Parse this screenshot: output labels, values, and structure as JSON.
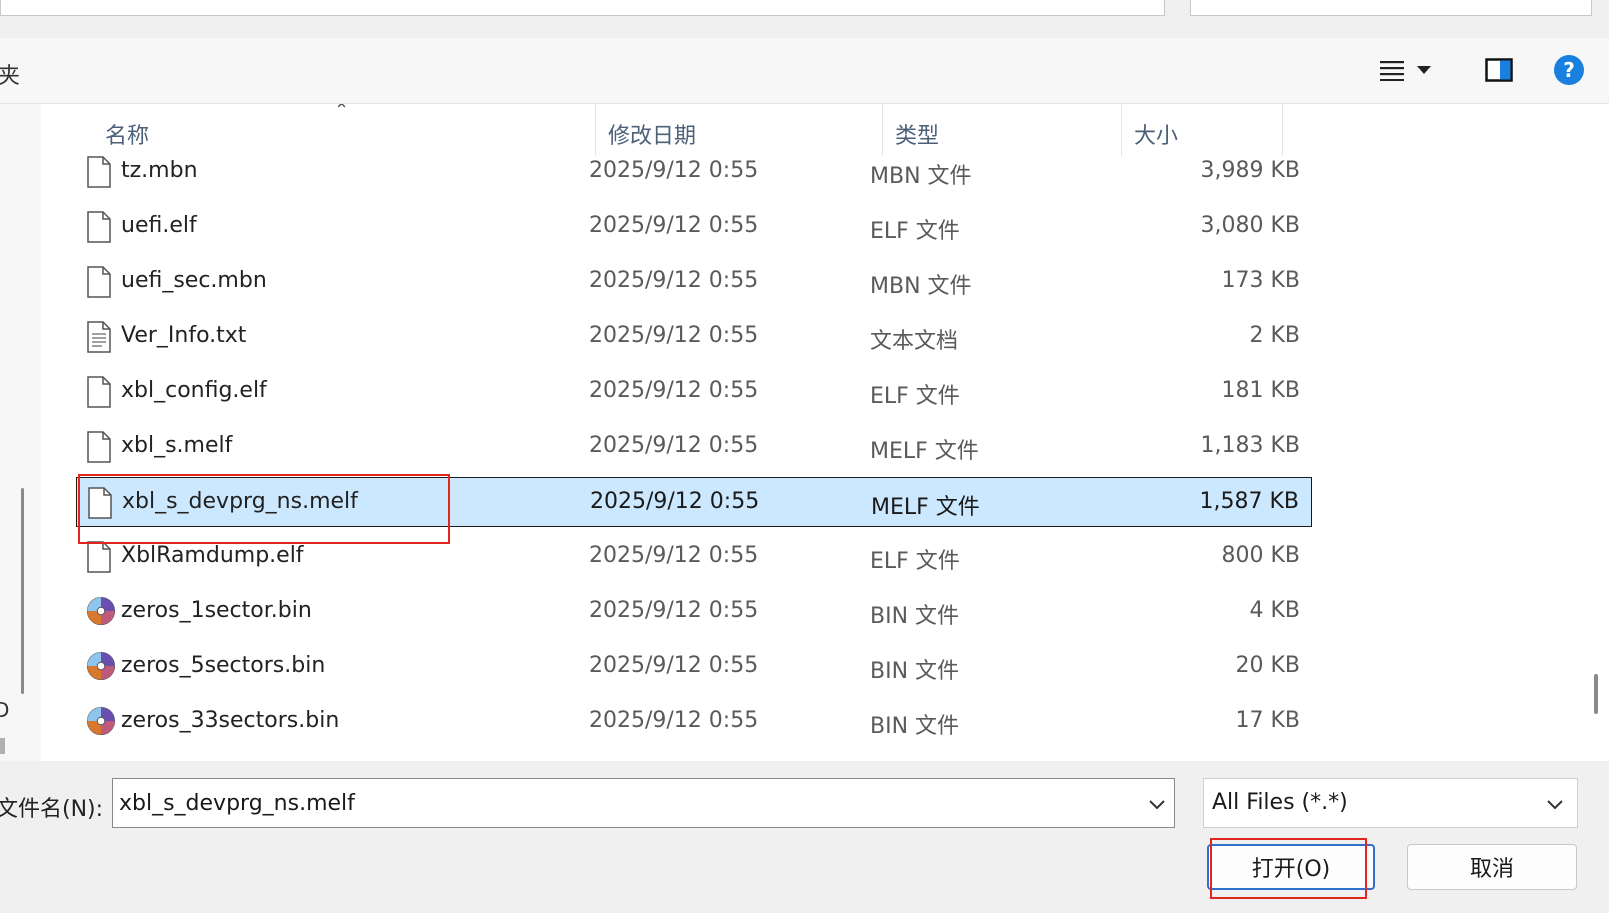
{
  "toolbar": {
    "label_fragment": "夹"
  },
  "left_pane": {
    "edge_char": "D"
  },
  "columns": {
    "name": "名称",
    "date": "修改日期",
    "type": "类型",
    "size": "大小"
  },
  "files": [
    {
      "name": "tz.mbn",
      "date": "2025/9/12 0:55",
      "type": "MBN 文件",
      "size": "3,989 KB",
      "icon": "file-icon"
    },
    {
      "name": "uefi.elf",
      "date": "2025/9/12 0:55",
      "type": "ELF 文件",
      "size": "3,080 KB",
      "icon": "file-icon"
    },
    {
      "name": "uefi_sec.mbn",
      "date": "2025/9/12 0:55",
      "type": "MBN 文件",
      "size": "173 KB",
      "icon": "file-icon"
    },
    {
      "name": "Ver_Info.txt",
      "date": "2025/9/12 0:55",
      "type": "文本文档",
      "size": "2 KB",
      "icon": "text-file-icon"
    },
    {
      "name": "xbl_config.elf",
      "date": "2025/9/12 0:55",
      "type": "ELF 文件",
      "size": "181 KB",
      "icon": "file-icon"
    },
    {
      "name": "xbl_s.melf",
      "date": "2025/9/12 0:55",
      "type": "MELF 文件",
      "size": "1,183 KB",
      "icon": "file-icon"
    },
    {
      "name": "xbl_s_devprg_ns.melf",
      "date": "2025/9/12 0:55",
      "type": "MELF 文件",
      "size": "1,587 KB",
      "icon": "file-icon",
      "selected": true
    },
    {
      "name": "XblRamdump.elf",
      "date": "2025/9/12 0:55",
      "type": "ELF 文件",
      "size": "800 KB",
      "icon": "file-icon"
    },
    {
      "name": "zeros_1sector.bin",
      "date": "2025/9/12 0:55",
      "type": "BIN 文件",
      "size": "4 KB",
      "icon": "disc-image-icon"
    },
    {
      "name": "zeros_5sectors.bin",
      "date": "2025/9/12 0:55",
      "type": "BIN 文件",
      "size": "20 KB",
      "icon": "disc-image-icon"
    },
    {
      "name": "zeros_33sectors.bin",
      "date": "2025/9/12 0:55",
      "type": "BIN 文件",
      "size": "17 KB",
      "icon": "disc-image-icon"
    }
  ],
  "filename": {
    "label": "文件名(N):",
    "value": "xbl_s_devprg_ns.melf"
  },
  "filetype": {
    "selected": "All Files (*.*)"
  },
  "buttons": {
    "open": "打开(O)",
    "cancel": "取消"
  },
  "colors": {
    "selection_bg": "#cce8ff",
    "highlight_box": "#e0261d",
    "help_icon": "#1a80e0"
  }
}
